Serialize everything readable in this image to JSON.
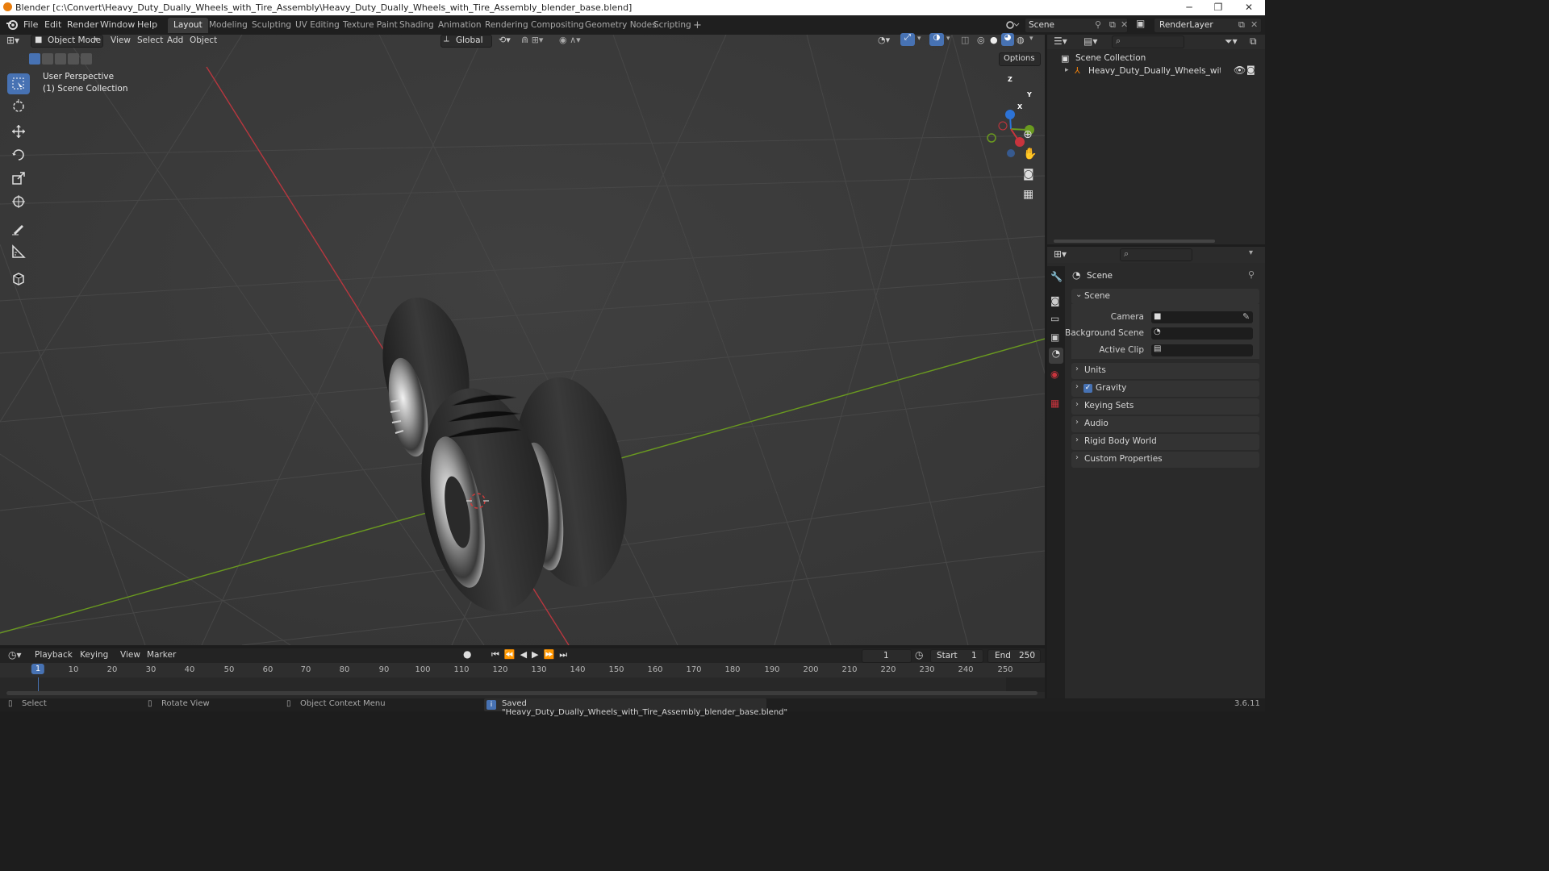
{
  "window": {
    "title": "Blender [c:\\Convert\\Heavy_Duty_Dually_Wheels_with_Tire_Assembly\\Heavy_Duty_Dually_Wheels_with_Tire_Assembly_blender_base.blend]",
    "minimize": "─",
    "maximize": "❐",
    "close": "✕"
  },
  "menu": [
    "File",
    "Edit",
    "Render",
    "Window",
    "Help"
  ],
  "workspaces": [
    "Layout",
    "Modeling",
    "Sculpting",
    "UV Editing",
    "Texture Paint",
    "Shading",
    "Animation",
    "Rendering",
    "Compositing",
    "Geometry Nodes",
    "Scripting"
  ],
  "workspace_add": "+",
  "scene_selector": {
    "value": "Scene"
  },
  "renderlayer_selector": {
    "value": "RenderLayer"
  },
  "viewport": {
    "mode": "Object Mode",
    "menus": [
      "View",
      "Select",
      "Add",
      "Object"
    ],
    "orientation": "Global",
    "options": "Options",
    "overlay_line1": "User Perspective",
    "overlay_line2": "(1) Scene Collection",
    "gizmo": {
      "x": "X",
      "y": "Y",
      "z": "Z"
    }
  },
  "timeline": {
    "menus": [
      "Playback",
      "Keying",
      "View",
      "Marker"
    ],
    "current_frame": "1",
    "start_label": "Start",
    "start": "1",
    "end_label": "End",
    "end": "250",
    "ruler": [
      "1",
      "10",
      "20",
      "30",
      "40",
      "50",
      "60",
      "70",
      "80",
      "90",
      "100",
      "110",
      "120",
      "130",
      "140",
      "150",
      "160",
      "170",
      "180",
      "190",
      "200",
      "210",
      "220",
      "230",
      "240",
      "250"
    ]
  },
  "status": {
    "select": "Select",
    "rotate": "Rotate View",
    "context": "Object Context Menu",
    "message": "Saved \"Heavy_Duty_Dually_Wheels_with_Tire_Assembly_blender_base.blend\"",
    "version": "3.6.11"
  },
  "outliner": {
    "root": "Scene Collection",
    "items": [
      "Heavy_Duty_Dually_Wheels_with_Tire_A"
    ]
  },
  "properties": {
    "context": "Scene",
    "panel_title": "Scene",
    "fields": [
      {
        "label": "Camera"
      },
      {
        "label": "Background Scene"
      },
      {
        "label": "Active Clip"
      }
    ],
    "sections": [
      "Units",
      "Gravity",
      "Keying Sets",
      "Audio",
      "Rigid Body World",
      "Custom Properties"
    ]
  },
  "colors": {
    "accent": "#4772b3",
    "x_axis": "#c8343d",
    "y_axis": "#6a9a1f",
    "z_axis": "#2d73d6",
    "blender_orange": "#e87d0d"
  }
}
